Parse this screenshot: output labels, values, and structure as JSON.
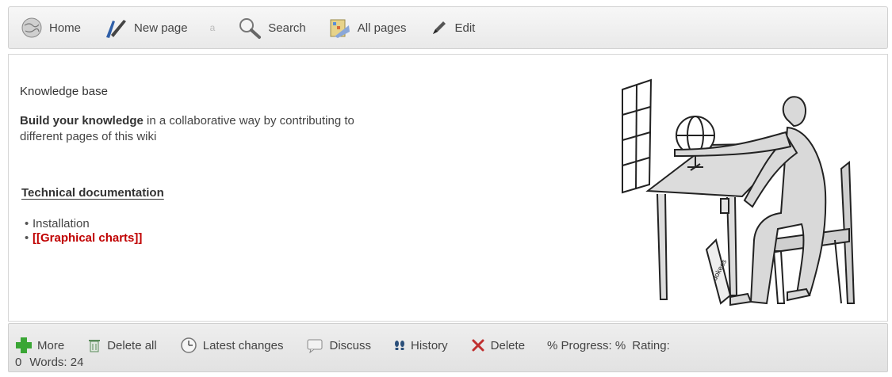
{
  "toolbar": {
    "home": "Home",
    "new_page": "New page",
    "separator": "a",
    "search": "Search",
    "all_pages": "All pages",
    "edit": "Edit"
  },
  "content": {
    "title": "Knowledge base",
    "intro_bold": "Build your knowledge",
    "intro_rest": " in a collaborative way by contributing to different pages of this wiki",
    "section_title": "Technical documentation",
    "list": [
      "Installation",
      "[[Graphical charts]]"
    ],
    "figure_label": "dokeos"
  },
  "footer": {
    "more": "More",
    "delete_all": "Delete all",
    "latest_changes": "Latest changes",
    "discuss": "Discuss",
    "history": "History",
    "delete": "Delete",
    "progress": "% Progress: %",
    "rating": "Rating:",
    "rating_value": "0",
    "words": "Words: 24"
  },
  "colors": {
    "missing_link": "#c00000",
    "add_icon": "#3aa635",
    "delete_icon": "#c03030"
  }
}
